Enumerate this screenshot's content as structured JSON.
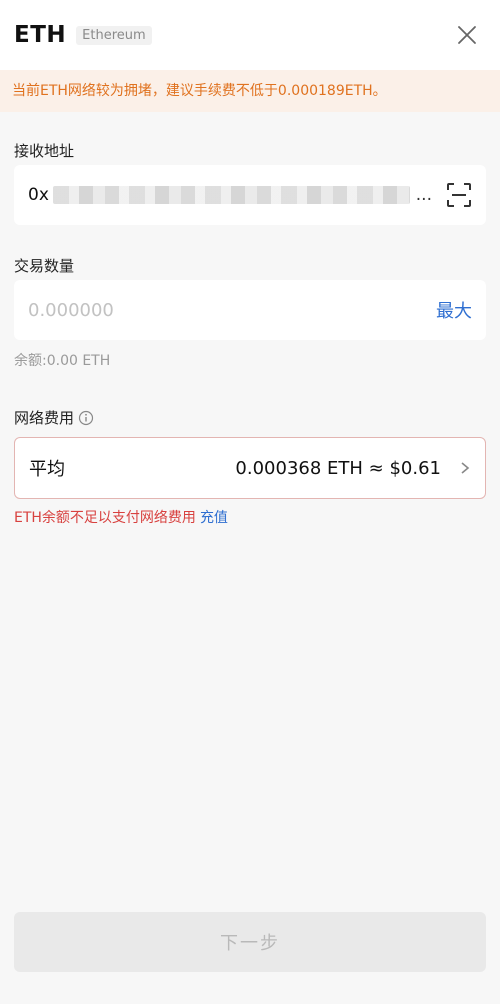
{
  "header": {
    "title": "ETH",
    "network": "Ethereum"
  },
  "warning": "当前ETH网络较为拥堵，建议手续费不低于0.000189ETH。",
  "address": {
    "label": "接收地址",
    "prefix": "0x",
    "ellipsis": "..."
  },
  "amount": {
    "label": "交易数量",
    "placeholder": "0.000000",
    "max_label": "最大",
    "balance": "余额:0.00 ETH"
  },
  "fee": {
    "label": "网络费用",
    "level": "平均",
    "value": "0.000368 ETH ≈ $0.61",
    "error": "ETH余额不足以支付网络费用",
    "recharge_label": "充值"
  },
  "next_button": "下一步",
  "colors": {
    "warning_text": "#e0721f",
    "warning_bg": "#fbf0e8",
    "link_blue": "#2f6fd1",
    "error_red": "#d8413f",
    "fee_border": "#e3b5b2"
  },
  "icons": {
    "close": "close-icon",
    "scan": "scan-icon",
    "info": "info-icon",
    "chevron": "chevron-right-icon"
  }
}
